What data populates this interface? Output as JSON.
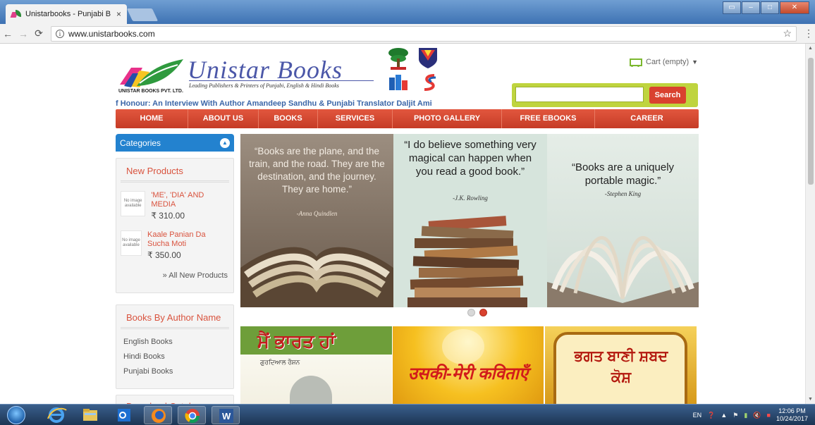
{
  "browser": {
    "tab_title": "Unistarbooks - Punjabi B",
    "tab_close": "×",
    "url": "www.unistarbooks.com"
  },
  "header": {
    "logo_company": "UNISTAR BOOKS PVT. LTD.",
    "brand": "Unistar Books",
    "tagline": "Leading Publishers & Printers of Punjabi, English & Hindi Books",
    "cart": "Cart (empty)",
    "search_button": "Search",
    "marquee": "f Honour: An Interview With Author Amandeep Sandhu & Punjabi Translator Daljit Ami"
  },
  "nav": [
    "HOME",
    "ABOUT US",
    "BOOKS",
    "SERVICES",
    "PHOTO GALLERY",
    "FREE EBOOKS",
    "CAREER"
  ],
  "sidebar": {
    "categories_title": "Categories",
    "new_products": {
      "title": "New Products",
      "no_image": "No image available",
      "items": [
        {
          "name": "'ME', 'DIA' AND MEDIA",
          "price": "₹ 310.00"
        },
        {
          "name": "Kaale Panian Da Sucha Moti",
          "price": "₹ 350.00"
        }
      ],
      "all_link": "» All New Products"
    },
    "authors": {
      "title": "Books By Author Name",
      "items": [
        "English Books",
        "Hindi Books",
        "Punjabi Books"
      ]
    },
    "next_box_title": "Download Catalogue"
  },
  "slider": {
    "quotes": [
      {
        "text": "“Books are the plane, and the train, and the road. They are the destination, and the journey. They are home.”",
        "author": "-Anna Quindlen"
      },
      {
        "text": "“I do believe something very magical can happen when you read a good book.”",
        "author": "-J.K. Rowling"
      },
      {
        "text": "“Books are a uniquely portable magic.”",
        "author": "-Stephen King"
      }
    ],
    "active_dot": 1
  },
  "covers": [
    {
      "title": "ਮੈਂ ਭਾਰਤ ਹਾਂ",
      "subtitle": "ਗੁਰਦਿਆਲ ਰੌਸ਼ਨ"
    },
    {
      "title": "उसकी-मेरी कविताएँ"
    },
    {
      "title": "ਭਗਤ ਬਾਣੀ ਸ਼ਬਦ ਕੋਸ਼"
    }
  ],
  "taskbar": {
    "lang": "EN",
    "time": "12:06 PM",
    "date": "10/24/2017"
  },
  "colors": {
    "accent_red": "#d9412f",
    "category_blue": "#2382cf",
    "search_green": "#bfd43e",
    "brand_blue": "#4b57a8"
  }
}
